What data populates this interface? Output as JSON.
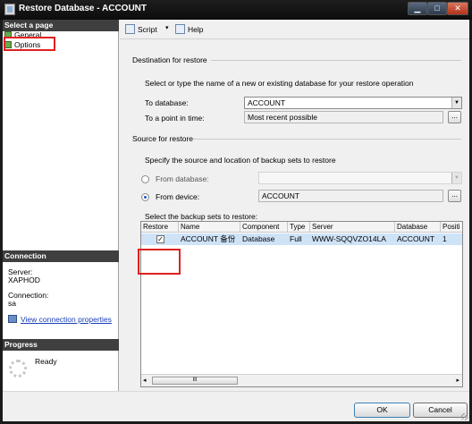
{
  "window": {
    "title": "Restore Database - ACCOUNT",
    "controls": {
      "minimize": "▁",
      "maximize": "□",
      "close": "✕"
    }
  },
  "left_pane": {
    "select_page_header": "Select a page",
    "pages": [
      {
        "label": "General",
        "icon": "page-icon",
        "selected": false
      },
      {
        "label": "Options",
        "icon": "page-icon",
        "selected": true
      }
    ],
    "connection": {
      "header": "Connection",
      "server_label": "Server:",
      "server_value": "XAPHOD",
      "connection_label": "Connection:",
      "connection_value": "sa",
      "view_link": "View connection properties"
    },
    "progress": {
      "header": "Progress",
      "status": "Ready"
    }
  },
  "toolbar": {
    "script_label": "Script",
    "dropdown_glyph": "▾",
    "help_label": "Help"
  },
  "destination": {
    "group_title": "Destination for restore",
    "description": "Select or type the name of a new or existing database for your restore operation",
    "to_database_label": "To database:",
    "to_database_value": "ACCOUNT",
    "to_point_label": "To a point in time:",
    "to_point_value": "Most recent possible",
    "browse_glyph": "..."
  },
  "source": {
    "group_title": "Source for restore",
    "description": "Specify the source and location of backup sets to restore",
    "from_database_label": "From database:",
    "from_database_value": "",
    "from_device_label": "From device:",
    "from_device_value": "ACCOUNT",
    "selected_option": "From device",
    "browse_glyph": "..."
  },
  "backup_sets": {
    "label": "Select the backup sets to restore:",
    "columns": [
      "Restore",
      "Name",
      "Component",
      "Type",
      "Server",
      "Database",
      "Positi"
    ],
    "rows": [
      {
        "restore": true,
        "check_glyph": "✓",
        "name": "ACCOUNT 备份",
        "component": "Database",
        "type": "Full",
        "server": "WWW-SQQVZO14LA",
        "database": "ACCOUNT",
        "position": "1"
      }
    ],
    "scroll": {
      "left": "◂",
      "right": "▸",
      "thumb_grip": "III"
    }
  },
  "buttons": {
    "ok": "OK",
    "cancel": "Cancel"
  },
  "colors": {
    "title_bar": "#111111",
    "section_header": "#3f3f3f",
    "selection_row": "#cfe3f7",
    "highlight_box": "#e02020",
    "link": "#1a3fb5",
    "close_button": "#c2462a"
  }
}
